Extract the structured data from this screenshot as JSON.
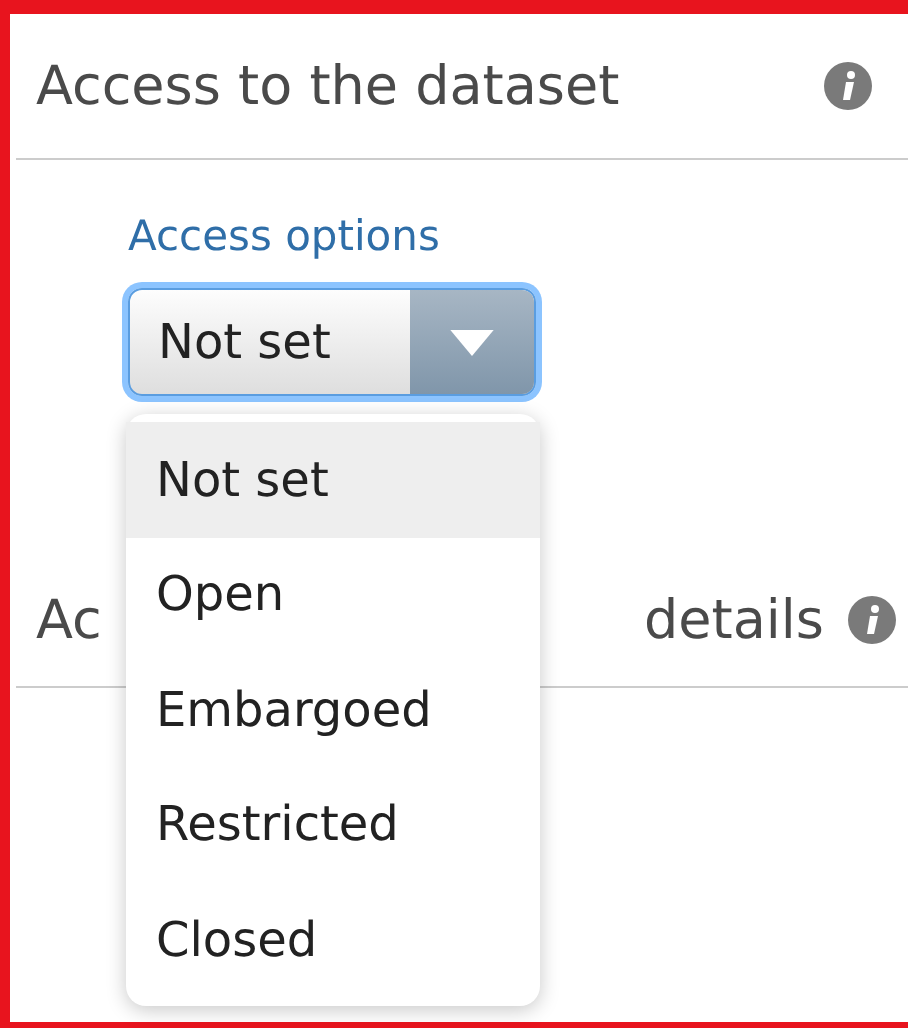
{
  "section_1": {
    "title": "Access to the dataset"
  },
  "field": {
    "label": "Access options",
    "value": "Not set",
    "expanded": true
  },
  "options": [
    {
      "label": "Not set",
      "selected": true
    },
    {
      "label": "Open",
      "selected": false
    },
    {
      "label": "Embargoed",
      "selected": false
    },
    {
      "label": "Restricted",
      "selected": false
    },
    {
      "label": "Closed",
      "selected": false
    }
  ],
  "section_2": {
    "title_start": "Ac",
    "title_end": "details"
  }
}
